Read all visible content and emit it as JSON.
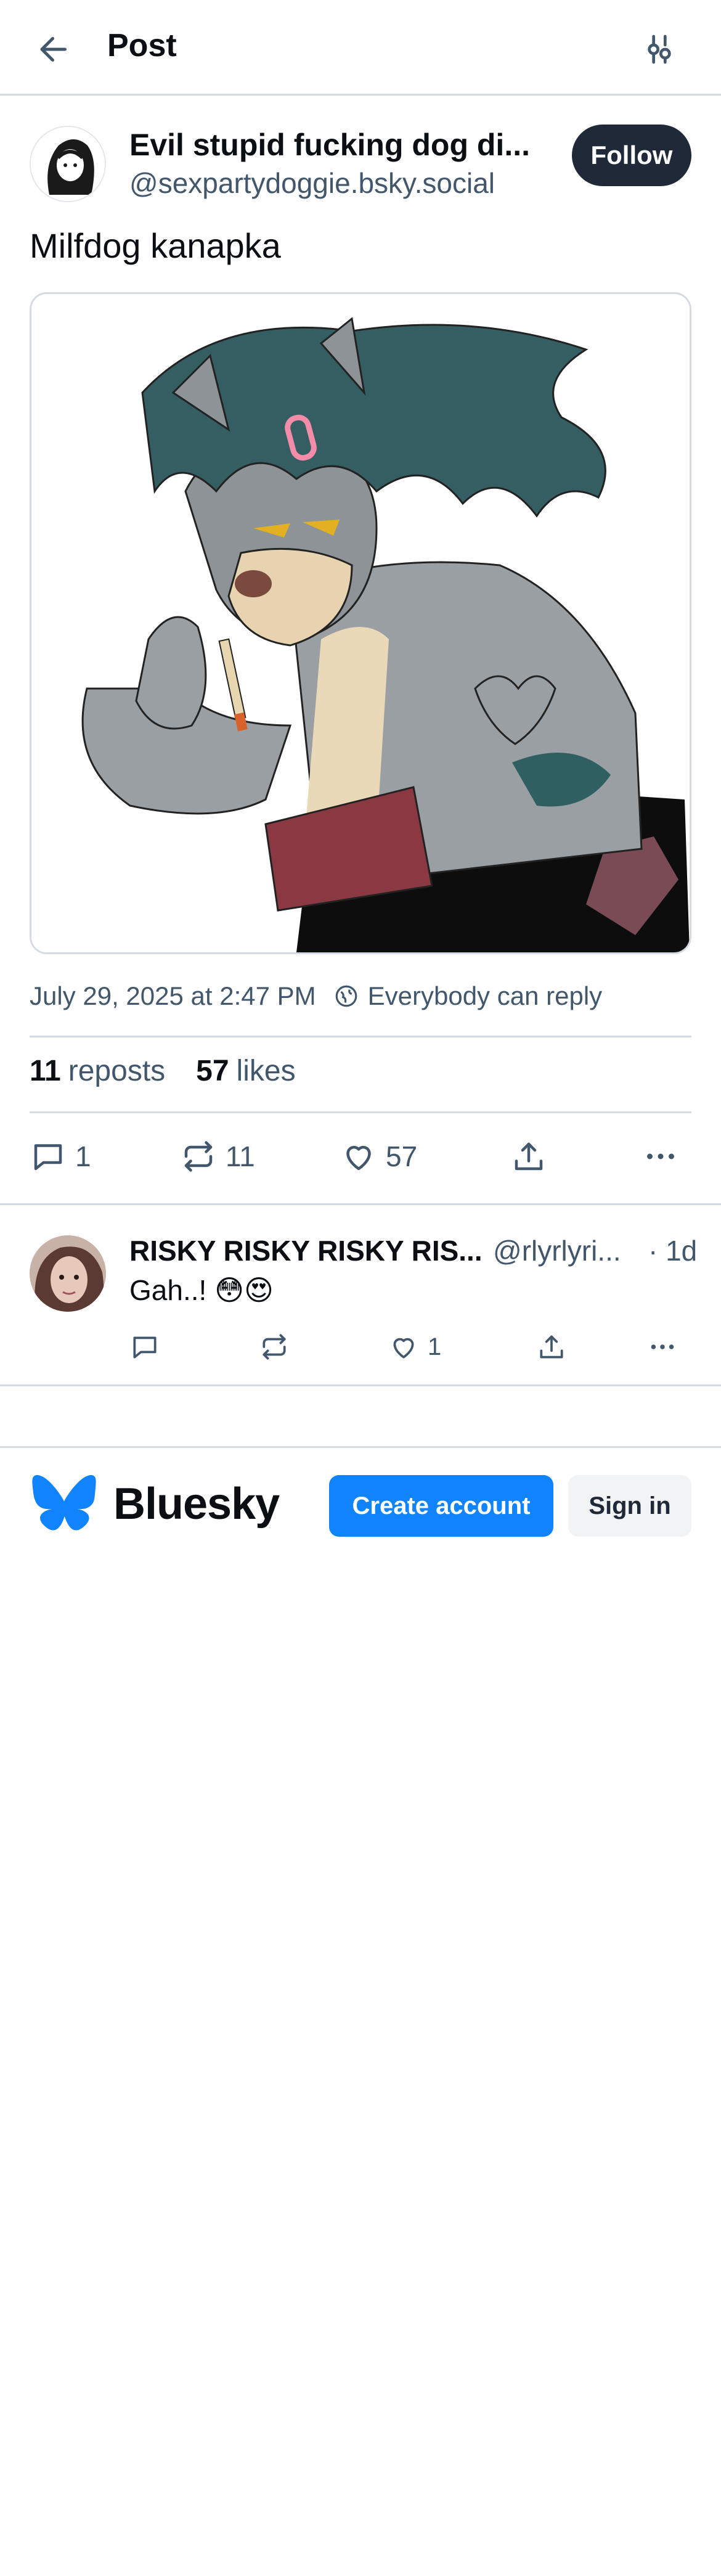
{
  "header": {
    "title": "Post"
  },
  "post": {
    "author_name": "Evil stupid fucking dog di...",
    "author_handle": "@sexpartydoggie.bsky.social",
    "follow_label": "Follow",
    "text": "Milfdog kanapka",
    "timestamp": "July 29, 2025 at 2:47 PM",
    "reply_setting": "Everybody can reply",
    "reposts_count": "11",
    "reposts_label": "reposts",
    "likes_count": "57",
    "likes_label": "likes",
    "actions": {
      "replies": "1",
      "reposts": "11",
      "likes": "57"
    }
  },
  "reply": {
    "author_name": "RISKY RISKY RISKY RIS...",
    "author_handle": "@rlyrlyri...",
    "time": "· 1d",
    "text": "Gah..! 😳😍",
    "actions": {
      "likes": "1"
    }
  },
  "footer": {
    "brand": "Bluesky",
    "create_account_label": "Create account",
    "sign_in_label": "Sign in"
  },
  "colors": {
    "accent": "#1083fe",
    "follow_bg": "#1f2937",
    "muted_text": "#42576c",
    "divider": "#d4dbe2"
  }
}
